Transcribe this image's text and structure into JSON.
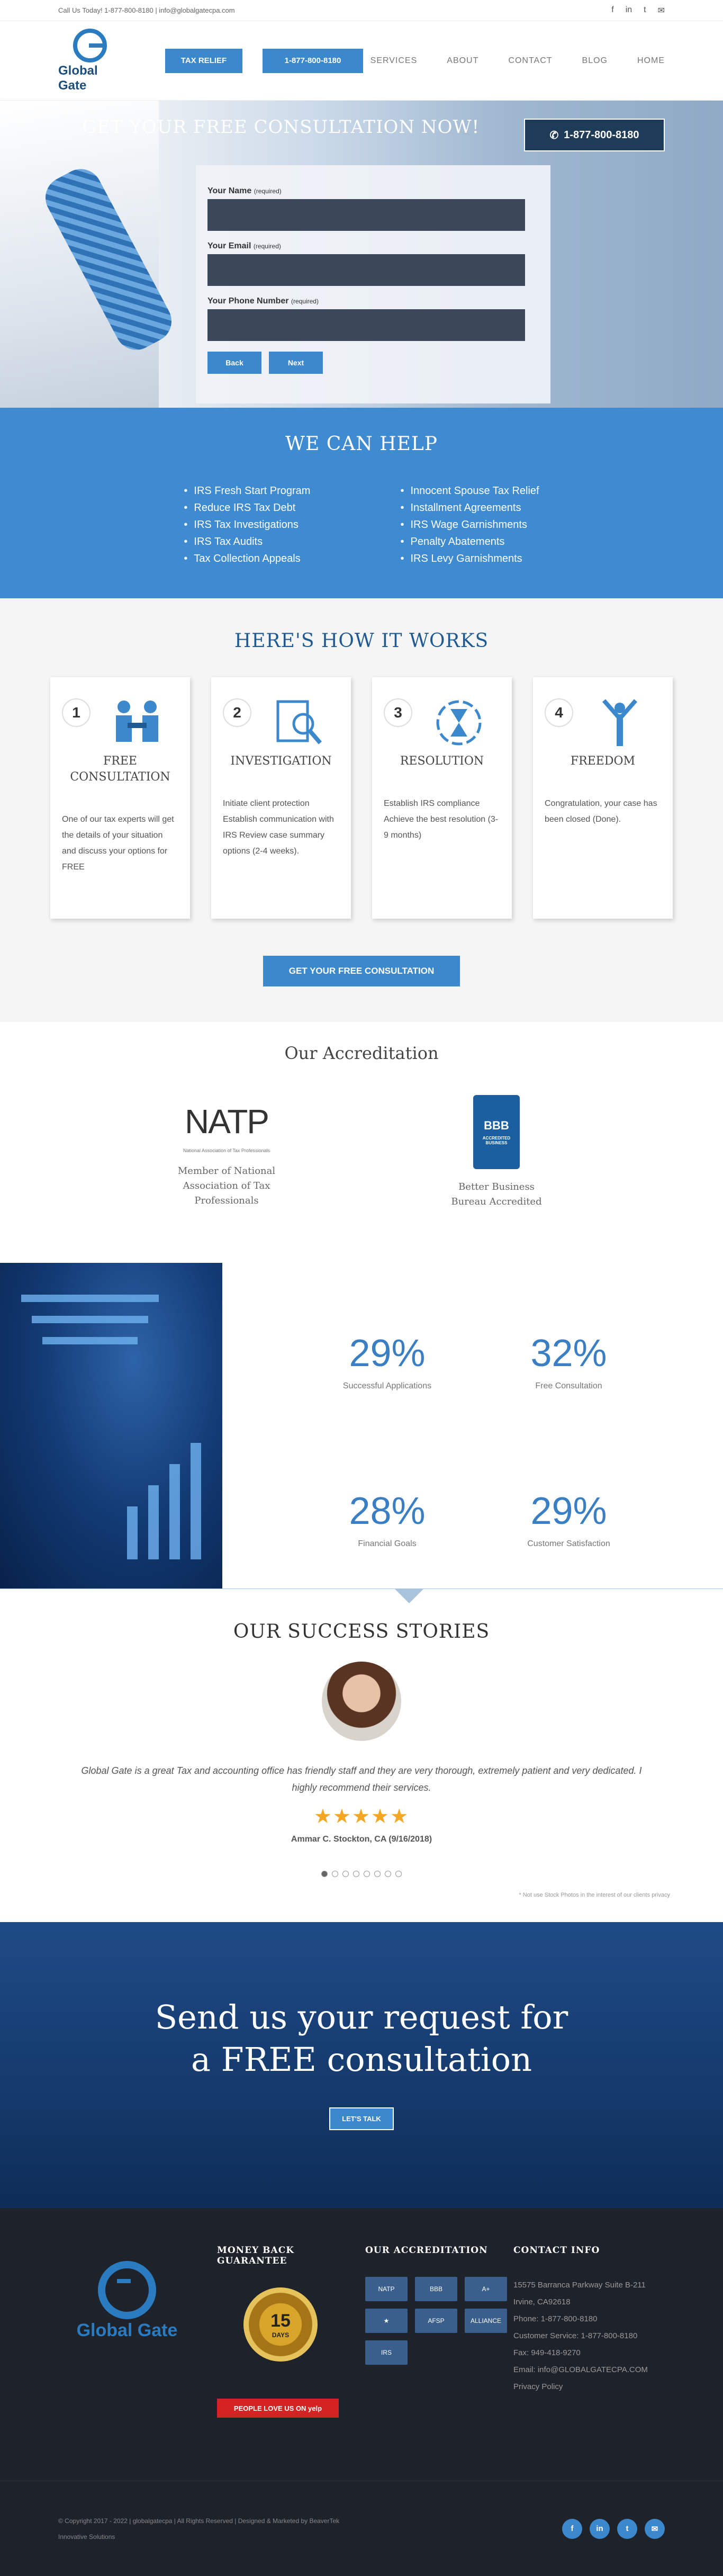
{
  "topbar": {
    "contact": "Call Us Today! 1-877-800-8180 | info@globalgatecpa.com",
    "social": [
      "f",
      "in",
      "t",
      "✉"
    ]
  },
  "header": {
    "logo_text": "Global Gate",
    "tax_relief": "TAX RELIEF",
    "phone": "1-877-800-8180",
    "nav": [
      "SERVICES",
      "ABOUT",
      "CONTACT",
      "BLOG",
      "HOME"
    ]
  },
  "hero": {
    "title": "GET YOUR FREE CONSULTATION NOW!",
    "phone_btn": "1-877-800-8180",
    "name_label": "Your Name",
    "email_label": "Your Email",
    "phone_label": "Your Phone Number",
    "required": "(required)",
    "back": "Back",
    "next": "Next"
  },
  "help": {
    "title": "WE CAN HELP",
    "left": [
      "IRS Fresh Start Program",
      "Reduce IRS Tax Debt",
      "IRS Tax Investigations",
      "IRS Tax Audits",
      "Tax Collection Appeals"
    ],
    "right": [
      "Innocent Spouse Tax Relief",
      "Installment Agreements",
      "IRS Wage Garnishments",
      "Penalty Abatements",
      "IRS Levy Garnishments"
    ]
  },
  "how": {
    "title": "HERE'S HOW IT WORKS",
    "steps": [
      {
        "num": "1",
        "title": "FREE CONSULTATION",
        "text": "One of our tax experts will get the details of your situation and discuss your options for FREE"
      },
      {
        "num": "2",
        "title": "INVESTIGATION",
        "text": "Initiate client protection Establish communication with IRS Review case summary options (2-4 weeks)."
      },
      {
        "num": "3",
        "title": "RESOLUTION",
        "text": "Establish IRS compliance Achieve the best resolution (3-9 months)"
      },
      {
        "num": "4",
        "title": "FREEDOM",
        "text": "Congratulation, your case has been closed (Done)."
      }
    ],
    "cta": "GET YOUR FREE CONSULTATION"
  },
  "accreditation": {
    "title": "Our Accreditation",
    "natp_logo": "NATP",
    "natp_sub": "National Association of Tax Professionals",
    "natp_caption": "Member of National Association of Tax Professionals",
    "bbb_logo": "BBB",
    "bbb_sub": "ACCREDITED BUSINESS",
    "bbb_caption": "Better Business Bureau Accredited"
  },
  "stats": [
    {
      "pct": "29%",
      "label": "Successful Applications"
    },
    {
      "pct": "32%",
      "label": "Free Consultation"
    },
    {
      "pct": "28%",
      "label": "Financial Goals"
    },
    {
      "pct": "29%",
      "label": "Customer Satisfaction"
    }
  ],
  "stories": {
    "title": "OUR SUCCESS STORIES",
    "quote": "Global Gate is a great Tax and accounting office has friendly staff and they are very thorough, extremely patient and very dedicated. I highly recommend their services.",
    "stars": "★★★★★",
    "author": "Ammar C. Stockton, CA (9/16/2018)",
    "disclaimer": "* Not use Stock Photos in the interest of our clients privacy"
  },
  "request": {
    "line1": "Send us your request for",
    "line2": "a FREE consultation",
    "button": "LET'S TALK"
  },
  "footer": {
    "logo_text": "Global Gate",
    "money_back": "MONEY BACK GUARANTEE",
    "seal_number": "15",
    "seal_text": "DAYS",
    "yelp": "PEOPLE LOVE US ON yelp",
    "accred_title": "OUR ACCREDITATION",
    "badges": [
      "NATP",
      "BBB",
      "A+",
      "★",
      "AFSP",
      "ALLIANCE",
      "IRS"
    ],
    "contact_title": "CONTACT INFO",
    "contact": [
      "15575 Barranca Parkway Suite B-211 Irvine, CA92618",
      "Phone: 1-877-800-8180",
      "Customer Service: 1-877-800-8180",
      "Fax: 949-418-9270",
      "Email: info@GLOBALGATECPA.COM",
      "Privacy Policy"
    ]
  },
  "bottom": {
    "copy": "© Copyright 2017 - 2022 | globalgatecpa | All Rights Reserved | Designed & Marketed by BeaverTek Innovative Solutions",
    "social": [
      "f",
      "in",
      "t",
      "✉"
    ]
  }
}
